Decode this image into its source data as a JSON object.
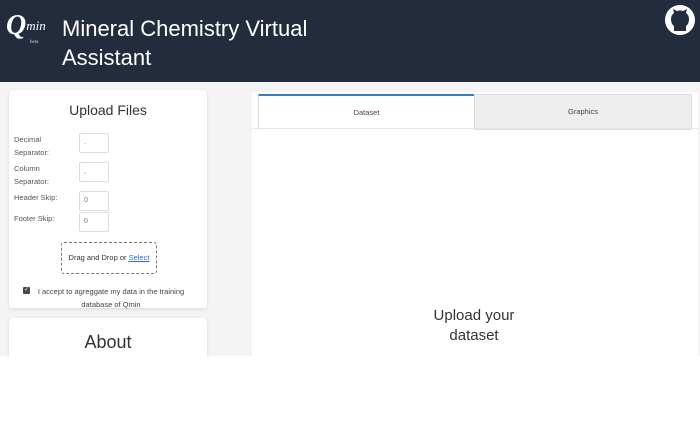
{
  "header": {
    "logo_main": "Q",
    "logo_suffix": "min",
    "logo_sub": "beta",
    "title": "Mineral Chemistry Virtual Assistant",
    "github_icon": "github-icon"
  },
  "colors": {
    "header_bg": "#222c3c",
    "accent": "#3a7fc1",
    "link": "#2a6fd1"
  },
  "upload": {
    "title": "Upload Files",
    "decimal_label": "Decimal Separator:",
    "decimal_value": ".",
    "column_label": "Column Separator:",
    "column_value": ",",
    "header_label": "Header Skip:",
    "header_value": "0",
    "footer_label": "Footer Skip:",
    "footer_value": "0",
    "drop_text": "Drag and Drop or ",
    "select_link": "Select",
    "accept_text": "I accept to agreggate my data in the training database of Qmin",
    "accept_checked": true
  },
  "about": {
    "title": "About"
  },
  "tabs": [
    {
      "label": "Dataset",
      "active": true
    },
    {
      "label": "Graphics",
      "active": false
    }
  ],
  "main": {
    "message": "Upload your dataset"
  }
}
